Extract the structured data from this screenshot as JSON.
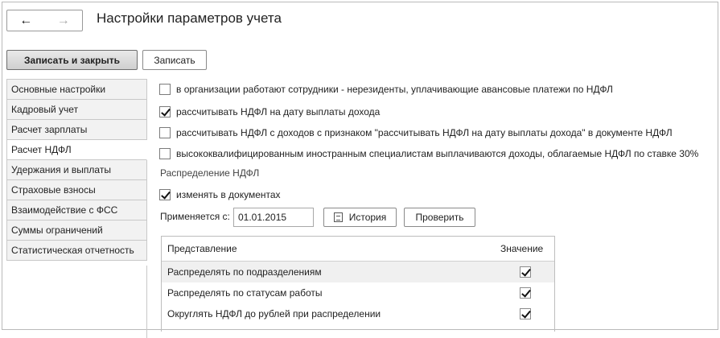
{
  "window": {
    "title": "Настройки параметров учета",
    "back_glyph": "←",
    "forward_glyph": "→"
  },
  "toolbar": {
    "save_close_label": "Записать и закрыть",
    "save_label": "Записать"
  },
  "sidebar": {
    "items": [
      {
        "label": "Основные настройки"
      },
      {
        "label": "Кадровый учет"
      },
      {
        "label": "Расчет зарплаты"
      },
      {
        "label": "Расчет НДФЛ"
      },
      {
        "label": "Удержания и выплаты"
      },
      {
        "label": "Страховые взносы"
      },
      {
        "label": "Взаимодействие с ФСС"
      },
      {
        "label": "Суммы ограничений"
      },
      {
        "label": "Статистическая отчетность"
      }
    ],
    "active": "Расчет НДФЛ"
  },
  "options": [
    {
      "label": "в организации работают сотрудники - нерезиденты, уплачивающие авансовые платежи по НДФЛ",
      "checked": false
    },
    {
      "label": "рассчитывать НДФЛ  на дату выплаты дохода",
      "checked": true
    },
    {
      "label": "рассчитывать НДФЛ с доходов с признаком \"рассчитывать НДФЛ на дату выплаты дохода\" в документе НДФЛ",
      "checked": false
    },
    {
      "label": "высококвалифицированным иностранным специалистам выплачиваются доходы, облагаемые НДФЛ по ставке 30%",
      "checked": false
    }
  ],
  "distribution": {
    "section_title": "Распределение НДФЛ",
    "change_in_docs_label": "изменять в документах",
    "change_in_docs_checked": true,
    "applies_from_label": "Применяется с:",
    "applies_from_value": "01.01.2015",
    "history_label": "История",
    "check_label": "Проверить"
  },
  "table": {
    "columns": [
      "Представление",
      "Значение"
    ],
    "rows": [
      {
        "name": "Распределять по подразделениям",
        "value": true
      },
      {
        "name": "Распределять по статусам работы",
        "value": true
      },
      {
        "name": "Округлять НДФЛ до рублей при распределении",
        "value": true
      }
    ]
  },
  "icons": {
    "back": "arrow-left-icon",
    "forward": "arrow-right-icon",
    "history": "history-icon",
    "checkbox": "checkbox-icon"
  }
}
